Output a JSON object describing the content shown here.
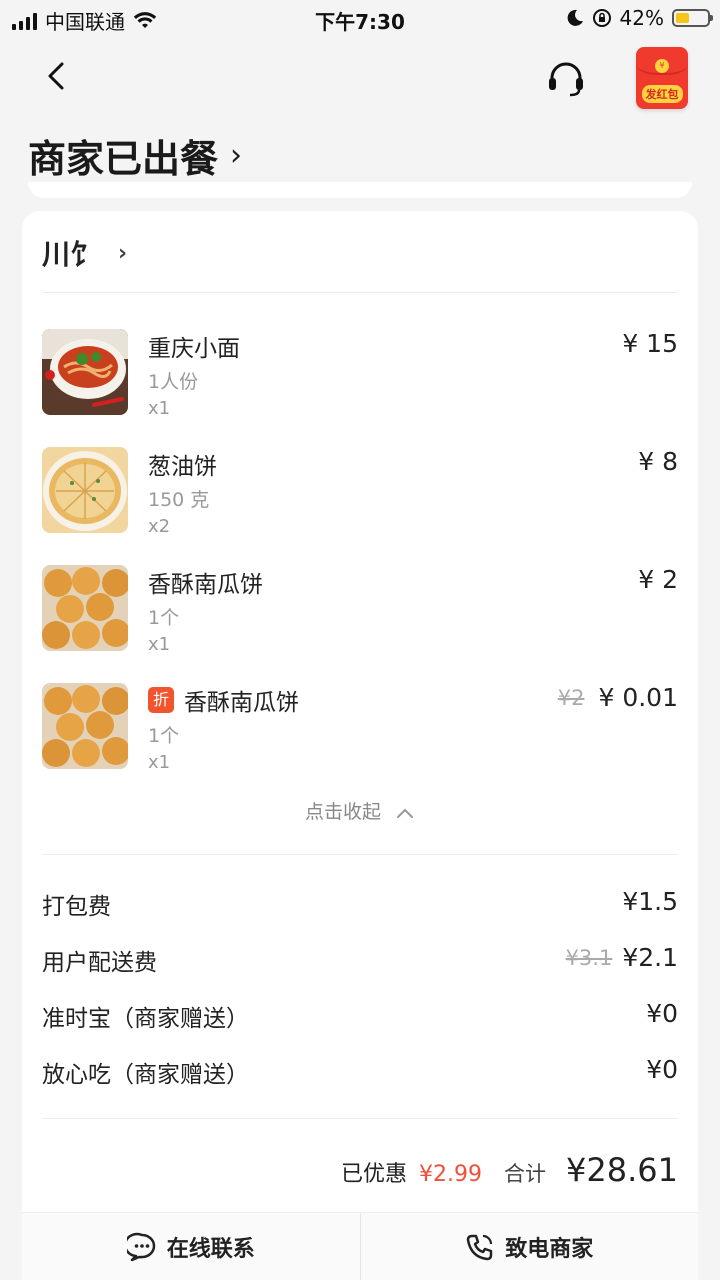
{
  "status_bar": {
    "carrier": "中国联通",
    "time": "下午7:30",
    "battery_percent": "42%",
    "battery_level": 0.42,
    "icons": [
      "signal-icon",
      "wifi-icon",
      "moon-icon",
      "rotation-lock-icon",
      "battery-icon"
    ]
  },
  "header": {
    "red_packet_label": "发红包",
    "coin_symbol": "¥",
    "order_status": "商家已出餐",
    "chevron": "›"
  },
  "shop": {
    "name": "川饣",
    "chevron": "›"
  },
  "items": [
    {
      "name": "重庆小面",
      "spec": "1人份",
      "qty": "x1",
      "price": "¥ 15",
      "old_price": "",
      "discount_tag": ""
    },
    {
      "name": "葱油饼",
      "spec": "150 克",
      "qty": "x2",
      "price": "¥ 8",
      "old_price": "",
      "discount_tag": ""
    },
    {
      "name": "香酥南瓜饼",
      "spec": "1个",
      "qty": "x1",
      "price": "¥ 2",
      "old_price": "",
      "discount_tag": ""
    },
    {
      "name": "香酥南瓜饼",
      "spec": "1个",
      "qty": "x1",
      "price": "¥ 0.01",
      "old_price": "¥2",
      "discount_tag": "折"
    }
  ],
  "collapse_label": "点击收起",
  "fees": [
    {
      "label": "打包费",
      "value": "¥1.5",
      "old_value": ""
    },
    {
      "label": "用户配送费",
      "value": "¥2.1",
      "old_value": "¥3.1"
    },
    {
      "label": "准时宝（商家赠送）",
      "value": "¥0",
      "old_value": ""
    },
    {
      "label": "放心吃（商家赠送）",
      "value": "¥0",
      "old_value": ""
    }
  ],
  "totals": {
    "discount_label": "已优惠",
    "discount_value": "¥2.99",
    "total_label": "合计",
    "total_value": "¥28.61"
  },
  "bottom_bar": {
    "chat_label": "在线联系",
    "call_label": "致电商家"
  },
  "colors": {
    "accent_red": "#f0503a",
    "red_packet": "#f03a2e",
    "battery_yellow": "#f5c518"
  }
}
